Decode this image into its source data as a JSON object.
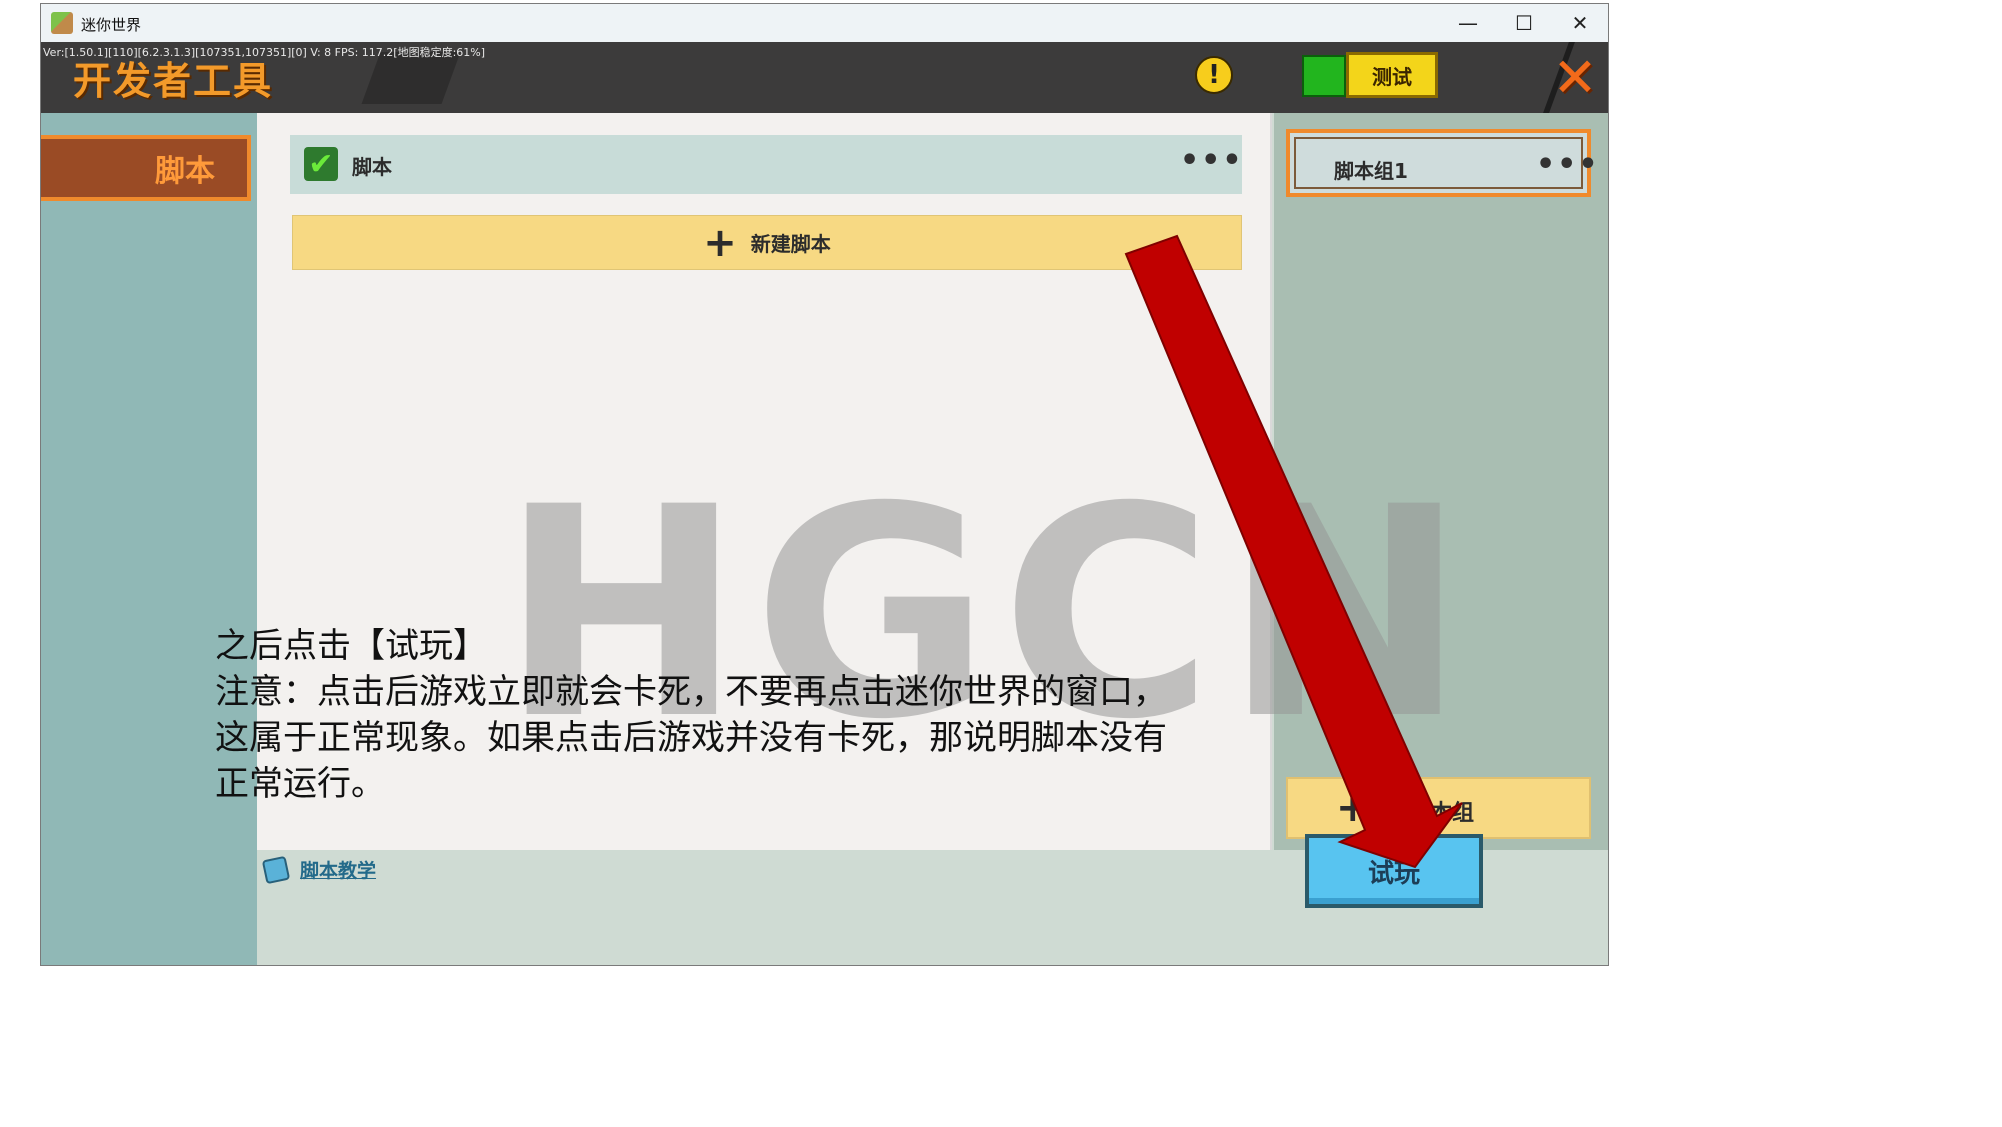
{
  "window": {
    "title": "迷你世界",
    "controls": [
      "—",
      "☐",
      "✕"
    ]
  },
  "topbar": {
    "version_text": "Ver:[1.50.1][110][6.2.3.1.3][107351,107351][0] V: 8 FPS: 117.2[地图稳定度:61%]",
    "title": "开发者工具",
    "test_label": "测试",
    "warn_glyph": "!",
    "close_glyph": "✕"
  },
  "sidebar": {
    "tabs": [
      {
        "label": "脚本"
      }
    ]
  },
  "scripts": {
    "row_label": "脚本",
    "more_glyph": "•••",
    "new_button_plus": "+",
    "new_button_label": "新建脚本"
  },
  "groups": {
    "card_label": "脚本组1",
    "more_glyph": "•••",
    "new_button_plus": "+",
    "new_button_label": "脚本组"
  },
  "bottom": {
    "tutorial_label": "脚本教学",
    "play_label": "试玩"
  },
  "overlay": {
    "watermark": "HGCN",
    "instruction_lines": [
      "之后点击【试玩】",
      "注意：点击后游戏立即就会卡死，不要再点击迷你世界的窗口，",
      "这属于正常现象。如果点击后游戏并没有卡死，那说明脚本没有",
      "正常运行。"
    ],
    "arrow_color": "#c00000"
  }
}
